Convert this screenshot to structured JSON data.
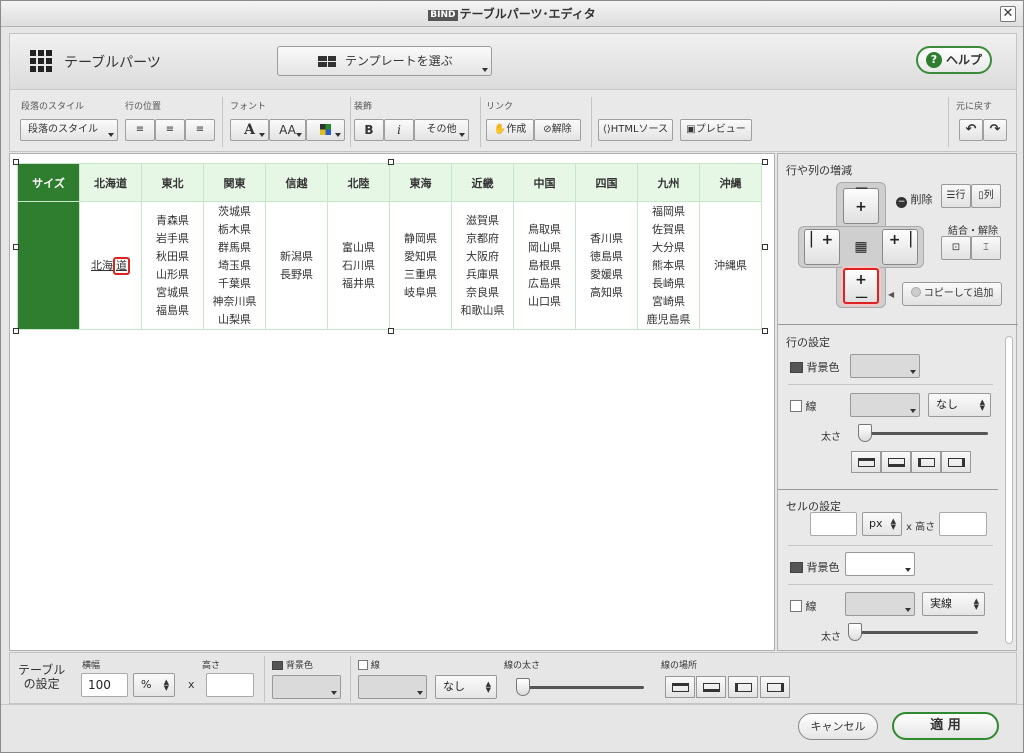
{
  "window": {
    "title": "テーブルパーツ･エディタ",
    "logo_text": "BIND",
    "close_glyph": "✕"
  },
  "header": {
    "title": "テーブルパーツ",
    "template_button": "テンプレートを選ぶ",
    "help_button": "ヘルプ"
  },
  "toolbar": {
    "para_style_label": "段落のスタイル",
    "para_style_value": "段落のスタイル",
    "row_pos_label": "行の位置",
    "font_label": "フォント",
    "font_a": "A",
    "font_aa": "AA",
    "decor_label": "装飾",
    "bold": "B",
    "italic": "i",
    "other": "その他",
    "link_label": "リンク",
    "link_create": "作成",
    "link_remove": "解除",
    "html_source": "HTMLソース",
    "preview": "プレビュー",
    "undo_label": "元に戻す",
    "undo": "↶",
    "redo": "↷"
  },
  "table": {
    "headers": [
      "サイズ",
      "北海道",
      "東北",
      "関東",
      "信越",
      "北陸",
      "東海",
      "近畿",
      "中国",
      "四国",
      "九州",
      "沖縄"
    ],
    "cells": [
      [],
      [
        "北海",
        "道"
      ],
      [
        "青森県",
        "岩手県",
        "秋田県",
        "山形県",
        "宮城県",
        "福島県"
      ],
      [
        "茨城県",
        "栃木県",
        "群馬県",
        "埼玉県",
        "千葉県",
        "神奈川県",
        "山梨県"
      ],
      [
        "新潟県",
        "長野県"
      ],
      [
        "富山県",
        "石川県",
        "福井県"
      ],
      [
        "静岡県",
        "愛知県",
        "三重県",
        "岐阜県"
      ],
      [
        "滋賀県",
        "京都府",
        "大阪府",
        "兵庫県",
        "奈良県",
        "和歌山県"
      ],
      [
        "鳥取県",
        "岡山県",
        "島根県",
        "広島県",
        "山口県"
      ],
      [
        "香川県",
        "徳島県",
        "愛媛県",
        "高知県"
      ],
      [
        "福岡県",
        "佐賀県",
        "大分県",
        "熊本県",
        "長崎県",
        "宮崎県",
        "鹿児島県"
      ],
      [
        "沖縄県"
      ]
    ]
  },
  "side": {
    "grow_title": "行や列の増減",
    "delete": "削除",
    "del_row": "行",
    "del_col": "列",
    "merge_split": "結合・解除",
    "copy_add": "コピーして追加",
    "plus": "+",
    "row_settings": "行の設定",
    "bg_color": "背景色",
    "line": "線",
    "line_style_none": "なし",
    "thickness": "太さ",
    "cell_settings": "セルの設定",
    "unit_px": "px",
    "times_height": "x 高さ",
    "cell_bg": "背景色",
    "cell_line": "線",
    "cell_line_style": "実線",
    "cell_thickness": "太さ"
  },
  "bottom": {
    "table_settings_1": "テーブル",
    "table_settings_2": "の設定",
    "width_label": "横幅",
    "width_value": "100",
    "width_unit": "%",
    "x": "x",
    "height_label": "高さ",
    "bg_color": "背景色",
    "line": "線",
    "line_style": "なし",
    "line_thickness": "線の太さ",
    "line_position": "線の場所"
  },
  "footer": {
    "cancel": "キャンセル",
    "apply": "適 用"
  },
  "colors": {
    "accent_green": "#2f7d2f",
    "header_bg": "#e6f7e6",
    "highlight_red": "#d22222"
  }
}
